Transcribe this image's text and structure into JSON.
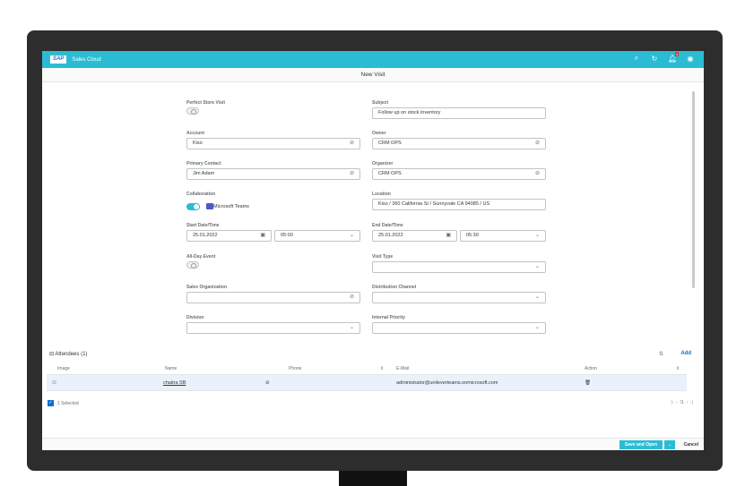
{
  "shell": {
    "logo": "SAP",
    "app_title": "Sales Cloud",
    "notification_count": "4"
  },
  "page_title": "New Visit",
  "left_fields": [
    {
      "label": "Perfect Store Visit",
      "type": "toggle-off"
    },
    {
      "label": "Account",
      "value": "Kiso",
      "icon": "link-icon"
    },
    {
      "label": "Primary Contact",
      "value": "Jim Adam",
      "icon": "link-icon"
    },
    {
      "label": "Collaboration",
      "type": "toggle-on",
      "value": "Microsoft Teams"
    },
    {
      "label": "Start Date/Time",
      "date": "25.01.2022",
      "time": "05:00"
    },
    {
      "label": "All-Day Event",
      "type": "toggle-off"
    },
    {
      "label": "Sales Organization",
      "value": "",
      "icon": "link-icon"
    },
    {
      "label": "Division",
      "value": "",
      "icon": "chevron-down-icon"
    }
  ],
  "right_fields": [
    {
      "label": "Subject",
      "value": "Follow up on stock inventory"
    },
    {
      "label": "Owner",
      "value": "CRM OPS",
      "icon": "link-icon"
    },
    {
      "label": "Organizer",
      "value": "CRM OPS",
      "icon": "link-icon"
    },
    {
      "label": "Location",
      "value": "Kiso / 360 California St / Sunnyvale CA 94085 / US"
    },
    {
      "label": "End Date/Time",
      "date": "25.01.2022",
      "time": "05:30"
    },
    {
      "label": "Visit Type",
      "value": "",
      "icon": "chevron-down-icon"
    },
    {
      "label": "Distribution Channel",
      "value": "",
      "icon": "chevron-down-icon"
    },
    {
      "label": "Internal Priority",
      "value": "",
      "icon": "chevron-down-icon"
    }
  ],
  "attendees": {
    "title": "Attendees",
    "count": "(1)",
    "add_label": "Add",
    "columns": [
      "Image",
      "Name",
      "Phone",
      "E-Mail",
      "Action"
    ],
    "rows": [
      {
        "name": "chaitra SB",
        "phone": "",
        "email": "administrator@unileverteams.onmicrosoft.com"
      }
    ],
    "selected_label": "1 Selected",
    "pager": "/1"
  },
  "footer": {
    "primary_label": "Save and Open",
    "cancel_label": "Cancel"
  },
  "colors": {
    "shell": "#2bbcd4",
    "accent": "#0a6ed1"
  }
}
